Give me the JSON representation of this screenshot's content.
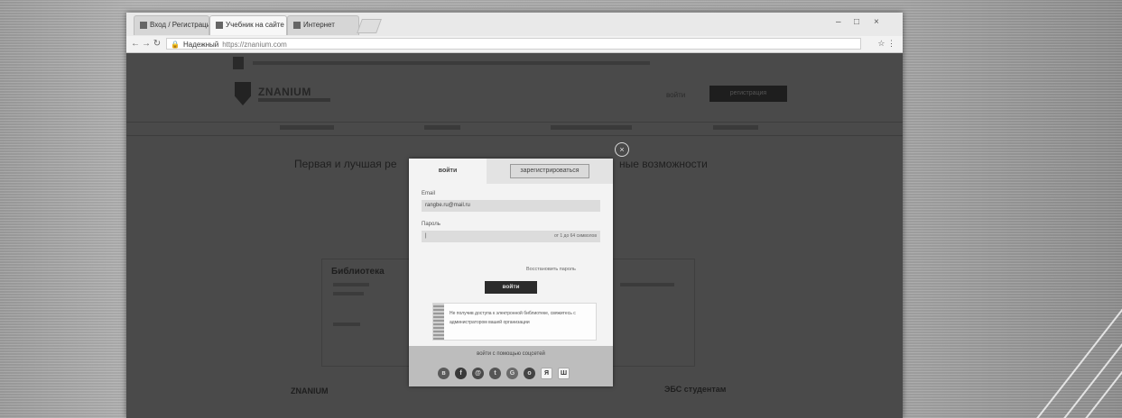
{
  "browser": {
    "tabs": [
      {
        "label": "Вход / Регистрация"
      },
      {
        "label": "Учебник на сайте"
      },
      {
        "label": "Интернет"
      }
    ],
    "url_scheme": "Надежный",
    "url_host": "https://znanium.com",
    "window_controls": [
      "–",
      "□",
      "×"
    ],
    "addr_right": "☆ ⋮"
  },
  "site": {
    "logo_text": "ZNANIUM",
    "login_link": "войти",
    "register_button": "регистрация",
    "headline_left": "Первая и лучшая ре",
    "headline_right": "ные возможности",
    "box_title": "Библиотека",
    "footer_left": "ZNANIUM",
    "footer_right": "ЭБС студентам"
  },
  "modal": {
    "close_glyph": "×",
    "tab_login": "войти",
    "tab_register": "зарегистрироваться",
    "email_label": "Email",
    "email_value": "rangbe.ru@mail.ru",
    "password_label": "Пароль",
    "password_hint": "от 1 до 64 символов",
    "forgot_link": "Восстановить пароль",
    "submit": "войти",
    "notice_text": "Не получив доступа к электронной библиотеке, свяжитесь с администратором вашей организации",
    "via_label": "войти с помощью соцсетей",
    "socials": [
      {
        "icon": "vk-icon",
        "glyph": "в",
        "color": "#5a5a5a"
      },
      {
        "icon": "facebook-icon",
        "glyph": "f",
        "color": "#3a3a3a"
      },
      {
        "icon": "mailru-icon",
        "glyph": "@",
        "color": "#4a4a4a"
      },
      {
        "icon": "twitter-icon",
        "glyph": "t",
        "color": "#555555"
      },
      {
        "icon": "google-icon",
        "glyph": "G",
        "color": "#6a6a6a"
      },
      {
        "icon": "odnoklassniki-icon",
        "glyph": "о",
        "color": "#444444"
      },
      {
        "icon": "yandex-icon",
        "glyph": "Я",
        "color": "square"
      },
      {
        "icon": "lms-icon",
        "glyph": "Ш",
        "color": "square"
      }
    ]
  }
}
